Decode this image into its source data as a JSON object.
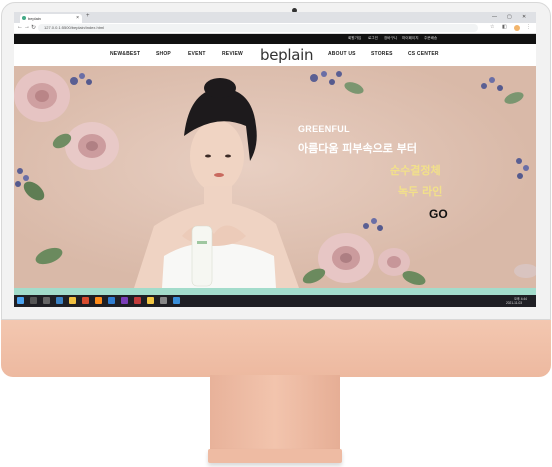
{
  "browser": {
    "tab_title": "beplain",
    "tab_close": "×",
    "new_tab": "+",
    "url": "127.0.0.1:5500/beplain/index.html",
    "min": "—",
    "max": "▢",
    "close": "✕"
  },
  "site": {
    "top_links": [
      "회원가입",
      "로그인",
      "장바구니",
      "마이페이지",
      "주문배송"
    ],
    "menu_left": [
      "NEW&BEST",
      "SHOP",
      "EVENT",
      "REVIEW"
    ],
    "logo": "beplain",
    "menu_right": [
      "ABOUT US",
      "STORES",
      "CS CENTER"
    ],
    "hero": {
      "eyebrow": "GREENFUL",
      "line1": "아름다움 피부속으로 부터",
      "line2": "순수결정체",
      "line3": "녹두 라인",
      "cta": "GO"
    },
    "colors": {
      "hero_bg": "#dfc1b2",
      "accent_green": "#f2e08a",
      "strip": "#a3dccb"
    }
  },
  "taskbar": {
    "time": "오후 4:44",
    "date": "2021-11-03"
  }
}
